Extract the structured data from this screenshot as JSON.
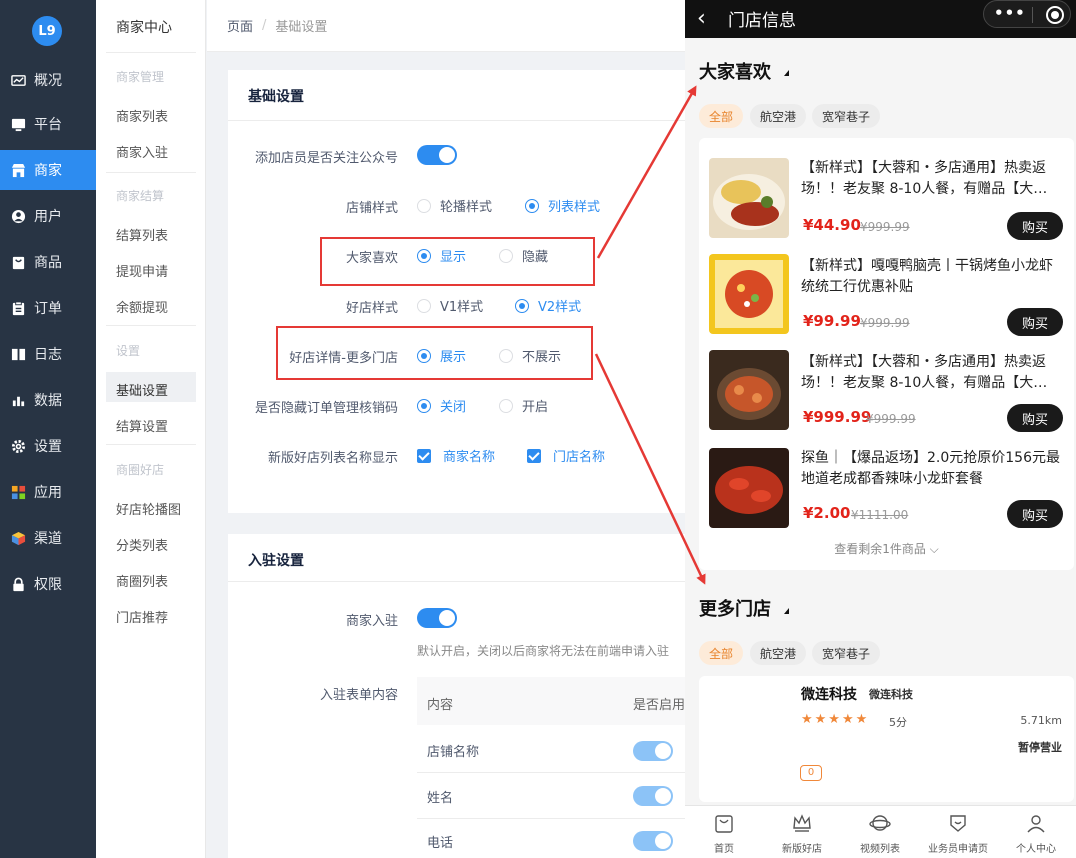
{
  "nav": {
    "logo": "L9",
    "items": [
      {
        "label": "概况",
        "icon": "chart-icon"
      },
      {
        "label": "平台",
        "icon": "monitor-icon"
      },
      {
        "label": "商家",
        "icon": "store-icon",
        "active": true
      },
      {
        "label": "用户",
        "icon": "user-icon"
      },
      {
        "label": "商品",
        "icon": "bag-icon"
      },
      {
        "label": "订单",
        "icon": "clipboard-icon"
      },
      {
        "label": "日志",
        "icon": "book-icon"
      },
      {
        "label": "数据",
        "icon": "bar-chart-icon"
      },
      {
        "label": "设置",
        "icon": "gear-icon"
      },
      {
        "label": "应用",
        "icon": "apps-icon"
      },
      {
        "label": "渠道",
        "icon": "cube-icon"
      },
      {
        "label": "权限",
        "icon": "lock-icon"
      }
    ]
  },
  "submenu": {
    "title": "商家中心",
    "groups": [
      {
        "head": "商家管理",
        "links": [
          "商家列表",
          "商家入驻"
        ]
      },
      {
        "head": "商家结算",
        "links": [
          "结算列表",
          "提现申请",
          "余额提现"
        ]
      },
      {
        "head": "设置",
        "links": [
          "基础设置",
          "结算设置"
        ],
        "selected": "基础设置"
      },
      {
        "head": "商圈好店",
        "links": [
          "好店轮播图",
          "分类列表",
          "商圈列表",
          "门店推荐"
        ]
      }
    ]
  },
  "breadcrumb": {
    "root": "页面",
    "sep": "/",
    "current": "基础设置"
  },
  "basic": {
    "title": "基础设置",
    "rows": {
      "follow_label": "添加店员是否关注公众号",
      "shop_style_label": "店铺样式",
      "shop_style_a": "轮播样式",
      "shop_style_b": "列表样式",
      "like_label": "大家喜欢",
      "like_a": "显示",
      "like_b": "隐藏",
      "good_style_label": "好店样式",
      "good_style_a": "V1样式",
      "good_style_b": "V2样式",
      "detail_label": "好店详情-更多门店",
      "detail_a": "展示",
      "detail_b": "不展示",
      "hide_label": "是否隐藏订单管理核销码",
      "hide_a": "关闭",
      "hide_b": "开启",
      "name_label": "新版好店列表名称显示",
      "name_a": "商家名称",
      "name_b": "门店名称"
    }
  },
  "join": {
    "title": "入驻设置",
    "join_label": "商家入驻",
    "join_hint": "默认开启，关闭以后商家将无法在前端申请入驻",
    "form_label": "入驻表单内容",
    "col_content": "内容",
    "col_enabled": "是否启用",
    "fields": [
      "店铺名称",
      "姓名",
      "电话"
    ]
  },
  "phone": {
    "title": "门店信息",
    "back": "‹",
    "caps_dots": "•••",
    "section_like": "大家喜欢",
    "section_more": "更多门店",
    "tags": [
      "全部",
      "航空港",
      "宽窄巷子"
    ],
    "products": [
      {
        "name": "【新样式】【大蓉和・多店通用】热卖返场！！老友聚 8-10人餐，有赠品【大…",
        "price": "¥44.90",
        "orig": "¥999.99",
        "buy": "购买"
      },
      {
        "name": "【新样式】嘎嘎鸭脑壳丨干锅烤鱼小龙虾统统工行优惠补贴",
        "price": "¥99.99",
        "orig": "¥999.99",
        "buy": "购买"
      },
      {
        "name": "【新样式】【大蓉和・多店通用】热卖返场！！老友聚 8-10人餐，有赠品【大…",
        "price": "¥999.99",
        "orig": "¥999.99",
        "buy": "购买"
      },
      {
        "name": "探鱼｜【爆品返场】2.0元抢原价156元最地道老成都香辣味小龙虾套餐",
        "price": "¥2.00",
        "orig": "¥1111.00",
        "buy": "购买"
      }
    ],
    "more_link": "查看剩余1件商品",
    "store": {
      "name": "微连科技",
      "sub": "微连科技",
      "stars": "★★★★★",
      "score": "5分",
      "distance": "5.71km",
      "status": "暂停营业",
      "badge": "0"
    },
    "tabs": [
      "首页",
      "新版好店",
      "视频列表",
      "业务员申请页",
      "个人中心"
    ]
  },
  "colors": {
    "primary": "#2d8cf0",
    "sidebar": "#283444",
    "annotation": "#e53935",
    "price": "#e2231a"
  }
}
